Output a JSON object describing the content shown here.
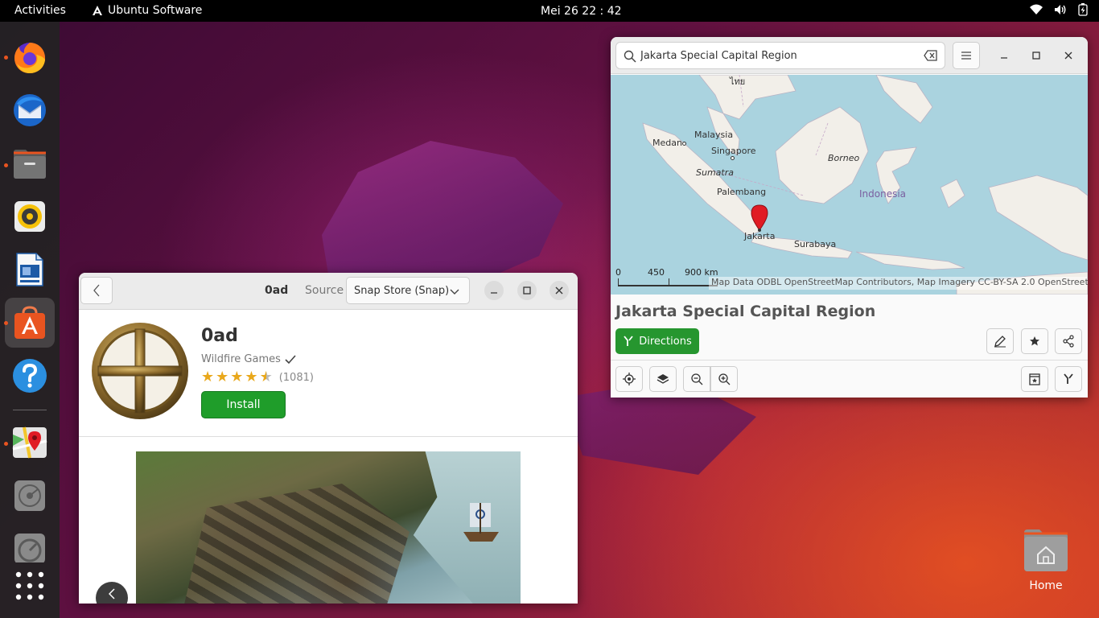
{
  "topbar": {
    "activities": "Activities",
    "app_menu": "Ubuntu Software",
    "clock": "Mei 26  22 : 42"
  },
  "dock": {
    "items": [
      "firefox",
      "thunderbird",
      "files",
      "rhythmbox",
      "libreoffice-impress",
      "ubuntu-software",
      "help",
      "maps",
      "disks",
      "disk-usage",
      "show-apps"
    ]
  },
  "desktop": {
    "home_label": "Home"
  },
  "software": {
    "title": "0ad",
    "source_label": "Source",
    "source_value": "Snap Store (Snap)",
    "app_name": "0ad",
    "developer": "Wildfire Games",
    "rating_stars": 4.5,
    "rating_count": "(1081)",
    "install_label": "Install"
  },
  "maps": {
    "search_value": "Jakarta Special Capital Region",
    "place_title": "Jakarta Special Capital Region",
    "directions_label": "Directions",
    "attribution": "Map Data ODBL OpenStreetMap Contributors, Map Imagery CC-BY-SA 2.0 OpenStreetMap",
    "scale": {
      "s0": "0",
      "s1": "450",
      "s2": "900 km"
    },
    "labels": {
      "thailand": "ไทย",
      "malaysia": "Malaysia",
      "medan": "Medan",
      "singapore": "Singapore",
      "sumatra": "Sumatra",
      "borneo": "Borneo",
      "palembang": "Palembang",
      "indonesia": "Indonesia",
      "jakarta": "Jakarta",
      "surabaya": "Surabaya"
    }
  },
  "colors": {
    "accent_green": "#26962f",
    "ubuntu_orange": "#e95420",
    "map_water": "#aad3df",
    "map_land": "#f2efe9"
  }
}
